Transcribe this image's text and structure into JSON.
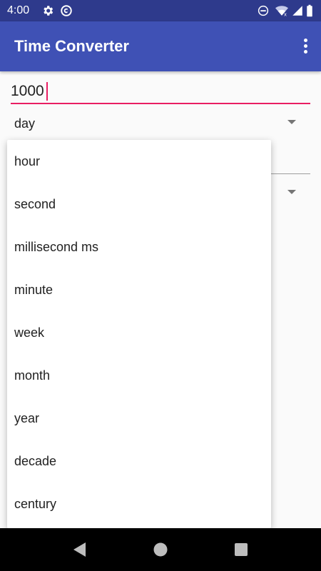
{
  "status_bar": {
    "time": "4:00",
    "icons": [
      "settings-gear-icon",
      "at-sign-icon",
      "do-not-disturb-icon",
      "wifi-icon",
      "signal-icon",
      "battery-icon"
    ]
  },
  "app_bar": {
    "title": "Time Converter",
    "overflow_icon": "more-vert-icon"
  },
  "converter": {
    "amount_value": "1000",
    "from_unit": "day",
    "to_unit": ""
  },
  "dropdown": {
    "options": [
      "hour",
      "second",
      "millisecond ms",
      "minute",
      "week",
      "month",
      "year",
      "decade",
      "century"
    ]
  },
  "nav_bar": {
    "icons": [
      "back-triangle-icon",
      "home-circle-icon",
      "recents-square-icon"
    ]
  },
  "colors": {
    "primary": "#3f51b5",
    "primary_dark": "#2e3a8c",
    "accent": "#e91e63",
    "background": "#fafafa"
  }
}
